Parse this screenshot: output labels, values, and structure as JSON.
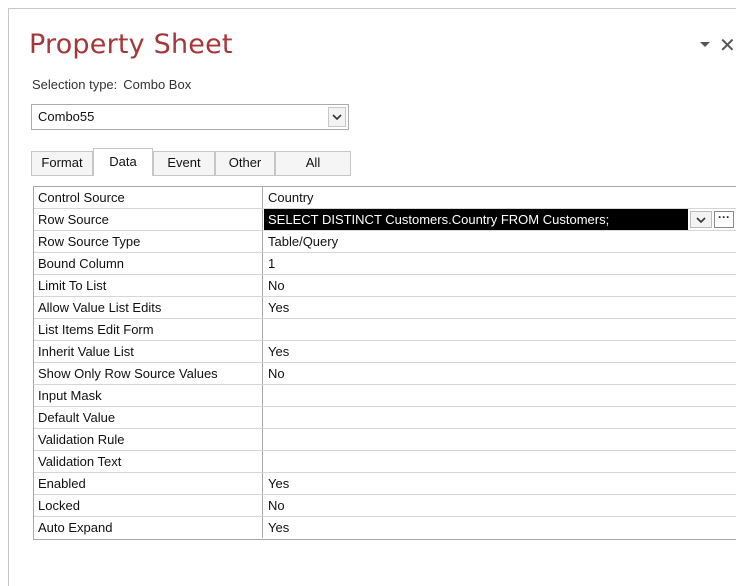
{
  "header": {
    "title": "Property Sheet",
    "selection_label": "Selection type:",
    "selection_type": "Combo Box"
  },
  "object_selector": {
    "value": "Combo55"
  },
  "tabs": [
    {
      "label": "Format",
      "active": false
    },
    {
      "label": "Data",
      "active": true
    },
    {
      "label": "Event",
      "active": false
    },
    {
      "label": "Other",
      "active": false
    },
    {
      "label": "All",
      "active": false
    }
  ],
  "properties": [
    {
      "name": "Control Source",
      "value": "Country"
    },
    {
      "name": "Row Source",
      "value": "SELECT DISTINCT Customers.Country FROM Customers;"
    },
    {
      "name": "Row Source Type",
      "value": "Table/Query"
    },
    {
      "name": "Bound Column",
      "value": "1"
    },
    {
      "name": "Limit To List",
      "value": "No"
    },
    {
      "name": "Allow Value List Edits",
      "value": "Yes"
    },
    {
      "name": "List Items Edit Form",
      "value": ""
    },
    {
      "name": "Inherit Value List",
      "value": "Yes"
    },
    {
      "name": "Show Only Row Source Values",
      "value": "No"
    },
    {
      "name": "Input Mask",
      "value": ""
    },
    {
      "name": "Default Value",
      "value": ""
    },
    {
      "name": "Validation Rule",
      "value": ""
    },
    {
      "name": "Validation Text",
      "value": ""
    },
    {
      "name": "Enabled",
      "value": "Yes"
    },
    {
      "name": "Locked",
      "value": "No"
    },
    {
      "name": "Auto Expand",
      "value": "Yes"
    }
  ],
  "builder_button": {
    "label": "···"
  },
  "colors": {
    "title": "#a4373a",
    "selected_bg": "#000000",
    "border": "#a8a8a8"
  },
  "icons": {
    "pin": "chevron-down-icon",
    "close": "close-icon",
    "dropdown": "chevron-down-icon"
  }
}
